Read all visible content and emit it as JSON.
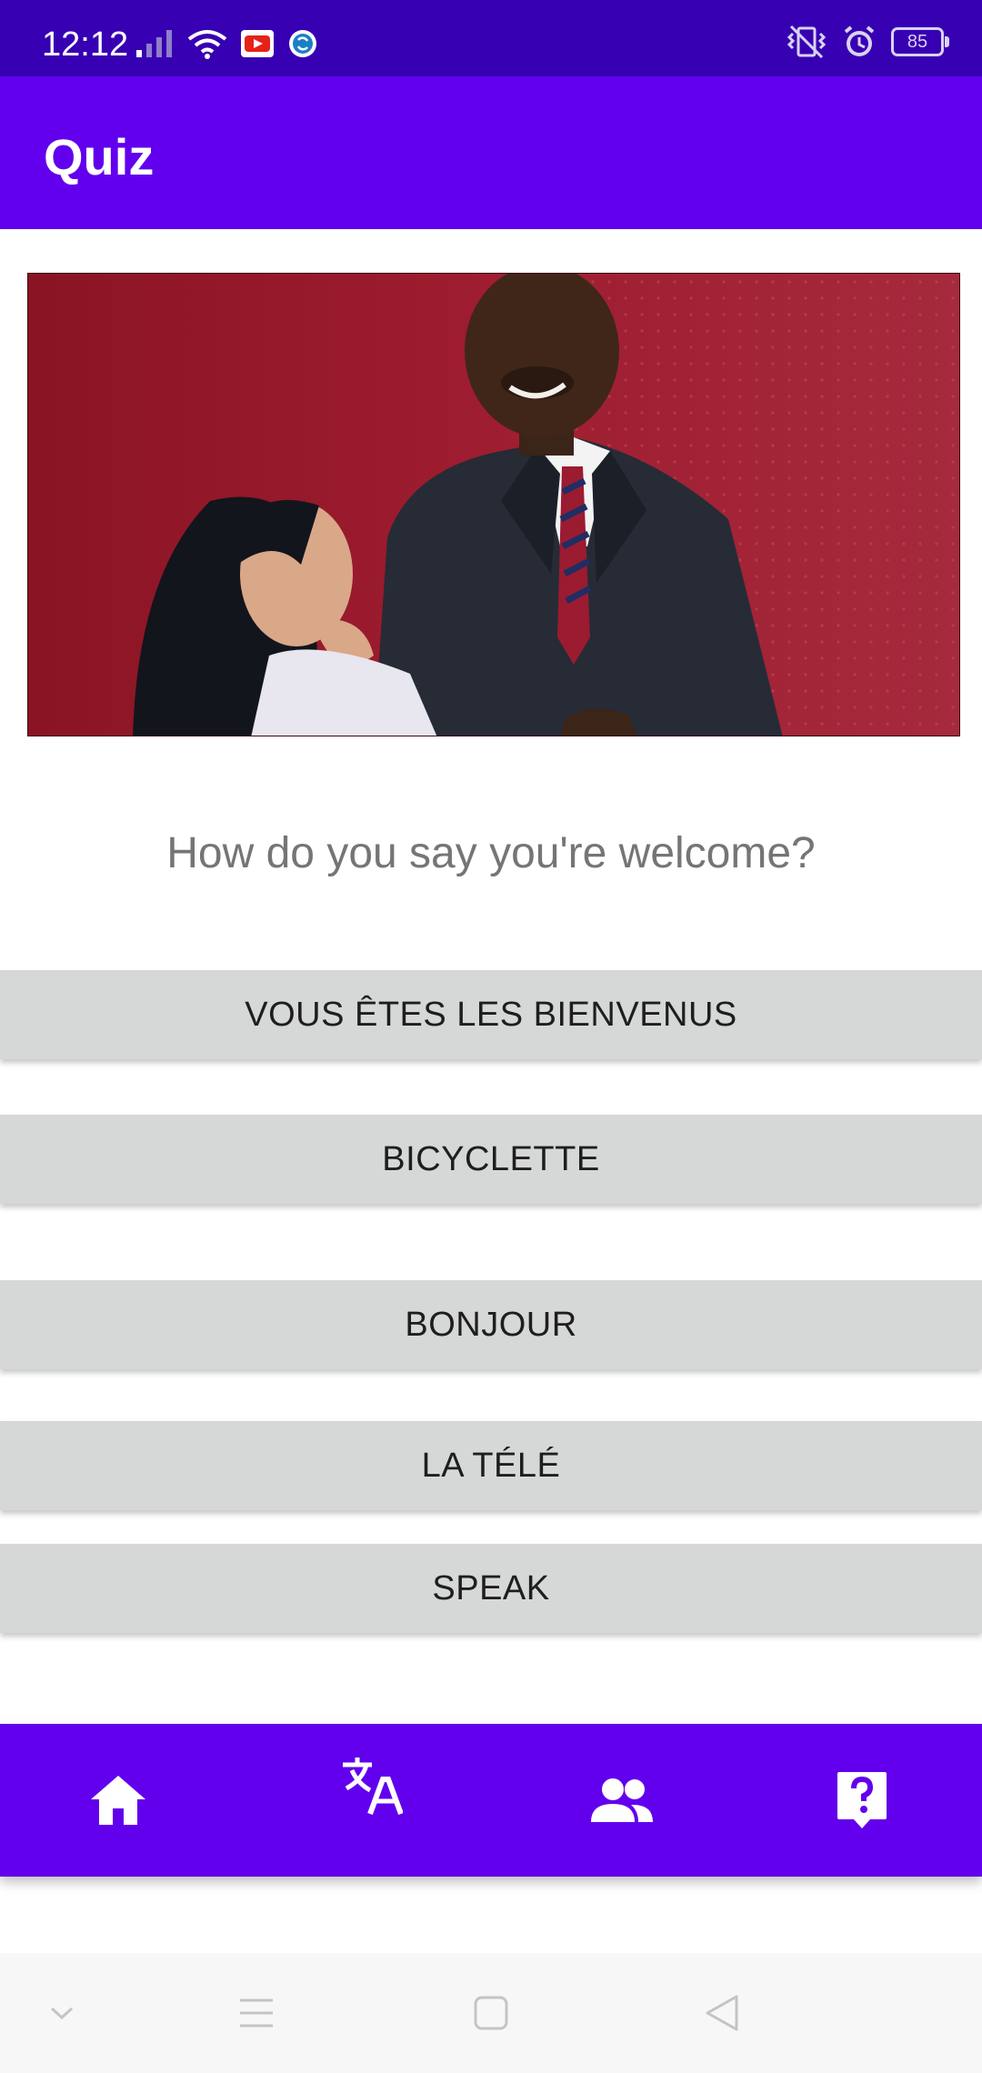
{
  "status_bar": {
    "time": "12:12",
    "battery": "85",
    "icons": [
      "signal-icon",
      "wifi-icon",
      "youtube-notification-icon",
      "sync-notification-icon",
      "vibrate-icon",
      "alarm-icon",
      "battery-icon"
    ]
  },
  "app_bar": {
    "title": "Quiz"
  },
  "hero_image": {
    "description_icon": "couple-photo"
  },
  "quiz": {
    "question": "How do you say you're welcome?",
    "answers": [
      "VOUS ÊTES LES BIENVENUS",
      "BICYCLETTE",
      "BONJOUR",
      "LA TÉLÉ",
      "SPEAK"
    ]
  },
  "bottom_nav": {
    "items": [
      "home-icon",
      "translate-icon",
      "people-icon",
      "quiz-icon"
    ]
  },
  "system_nav": {
    "items": [
      "collapse-icon",
      "menu-icon",
      "home-square-icon",
      "back-icon"
    ]
  },
  "colors": {
    "status_bar": "#3700b3",
    "primary": "#6200ee",
    "button": "#d6d7d7",
    "question_text": "#757575"
  }
}
